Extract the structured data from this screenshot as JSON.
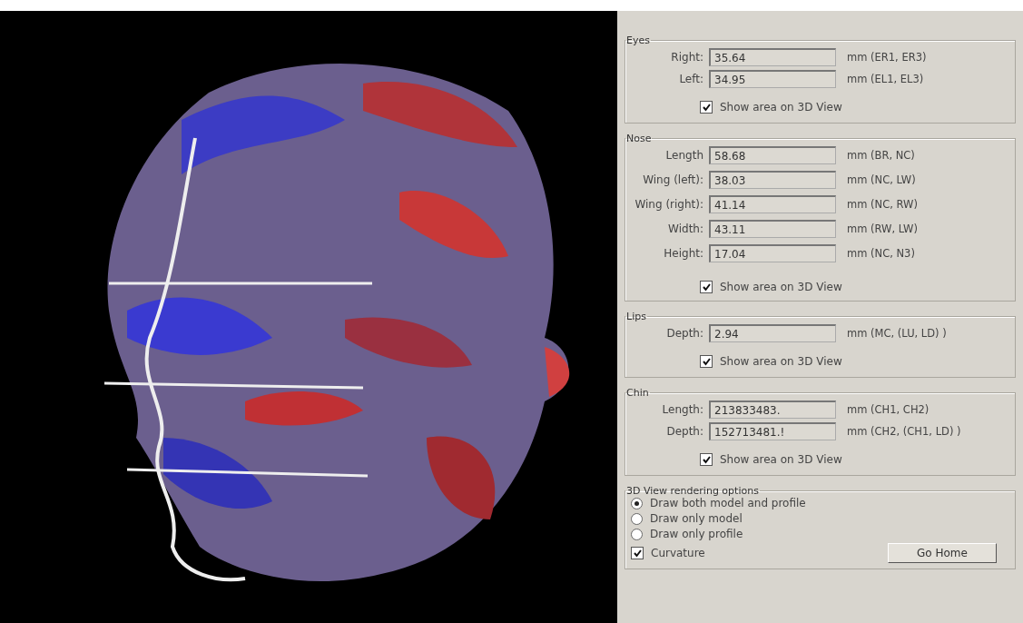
{
  "groups": [
    {
      "title": "Eyes",
      "fields": [
        {
          "label": "Right:",
          "value": "35.64",
          "unit": "mm (ER1, ER3)"
        },
        {
          "label": "Left:",
          "value": "34.95",
          "unit": "mm (EL1, EL3)"
        }
      ],
      "show_area": {
        "label": "Show area on 3D View",
        "checked": true
      }
    },
    {
      "title": "Nose",
      "fields": [
        {
          "label": "Length",
          "value": "58.68",
          "unit": "mm (BR, NC)"
        },
        {
          "label": "Wing (left):",
          "value": "38.03",
          "unit": "mm (NC, LW)"
        },
        {
          "label": "Wing (right):",
          "value": "41.14",
          "unit": "mm (NC, RW)"
        },
        {
          "label": "Width:",
          "value": "43.11",
          "unit": "mm (RW, LW)"
        },
        {
          "label": "Height:",
          "value": "17.04",
          "unit": "mm (NC, N3)"
        }
      ],
      "show_area": {
        "label": "Show area on 3D View",
        "checked": true
      }
    },
    {
      "title": "Lips",
      "fields": [
        {
          "label": "Depth:",
          "value": "2.94",
          "unit": "mm (MC, (LU, LD) )"
        }
      ],
      "show_area": {
        "label": "Show area on 3D View",
        "checked": true
      }
    },
    {
      "title": "Chin",
      "fields": [
        {
          "label": "Length:",
          "value": "213833483.",
          "unit": "mm (CH1, CH2)"
        },
        {
          "label": "Depth:",
          "value": "152713481.!",
          "unit": "mm (CH2, (CH1, LD) )"
        }
      ],
      "show_area": {
        "label": "Show area on 3D View",
        "checked": true
      }
    }
  ],
  "rendering": {
    "title": "3D View rendering options",
    "options": [
      {
        "label": "Draw both model and profile",
        "selected": true
      },
      {
        "label": "Draw only model",
        "selected": false
      },
      {
        "label": "Draw only profile",
        "selected": false
      }
    ],
    "curvature": {
      "label": "Curvature",
      "checked": true
    },
    "button": "Go Home"
  }
}
